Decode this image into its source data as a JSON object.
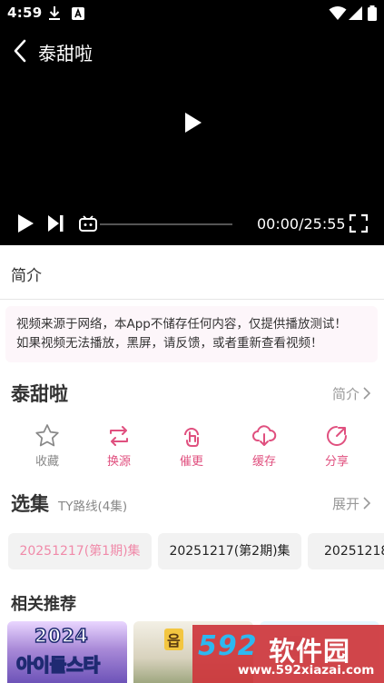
{
  "status_bar": {
    "time": "4:59"
  },
  "player": {
    "title": "泰甜啦",
    "time_display": "00:00/25:55",
    "progress": 0
  },
  "intro_tab": {
    "label": "简介"
  },
  "notice": {
    "line1": "视频来源于网络，本App不储存任何内容，仅提供播放测试！",
    "line2": "如果视频无法播放，黑屏，请反馈，或者重新查看视频！"
  },
  "show": {
    "title": "泰甜啦",
    "intro_link": "简介"
  },
  "actions": [
    {
      "label": "收藏",
      "icon": "star-icon",
      "color": "#888888"
    },
    {
      "label": "换源",
      "icon": "swap-source-icon",
      "color": "#e0507f"
    },
    {
      "label": "催更",
      "icon": "urge-update-icon",
      "color": "#e0507f"
    },
    {
      "label": "缓存",
      "icon": "cloud-download-icon",
      "color": "#e0507f"
    },
    {
      "label": "分享",
      "icon": "share-icon",
      "color": "#e0507f"
    }
  ],
  "episodes": {
    "title": "选集",
    "route": "TY路线(4集)",
    "expand_label": "展开",
    "items": [
      {
        "label": "20251217(第1期)集",
        "active": true
      },
      {
        "label": "20251217(第2期)集",
        "active": false
      },
      {
        "label": "20251218",
        "active": false
      }
    ]
  },
  "recommend": {
    "title": "相关推荐",
    "thumbs": [
      {
        "year": "2024",
        "text": "아이돌스타"
      },
      {
        "badge": "읍"
      }
    ]
  },
  "watermark": {
    "logo": "592",
    "name": "软件园",
    "url": "www.592xiazai.com"
  },
  "colors": {
    "accent": "#e0507f",
    "active_episode": "#f08aa9",
    "player_bg": "#000000"
  }
}
